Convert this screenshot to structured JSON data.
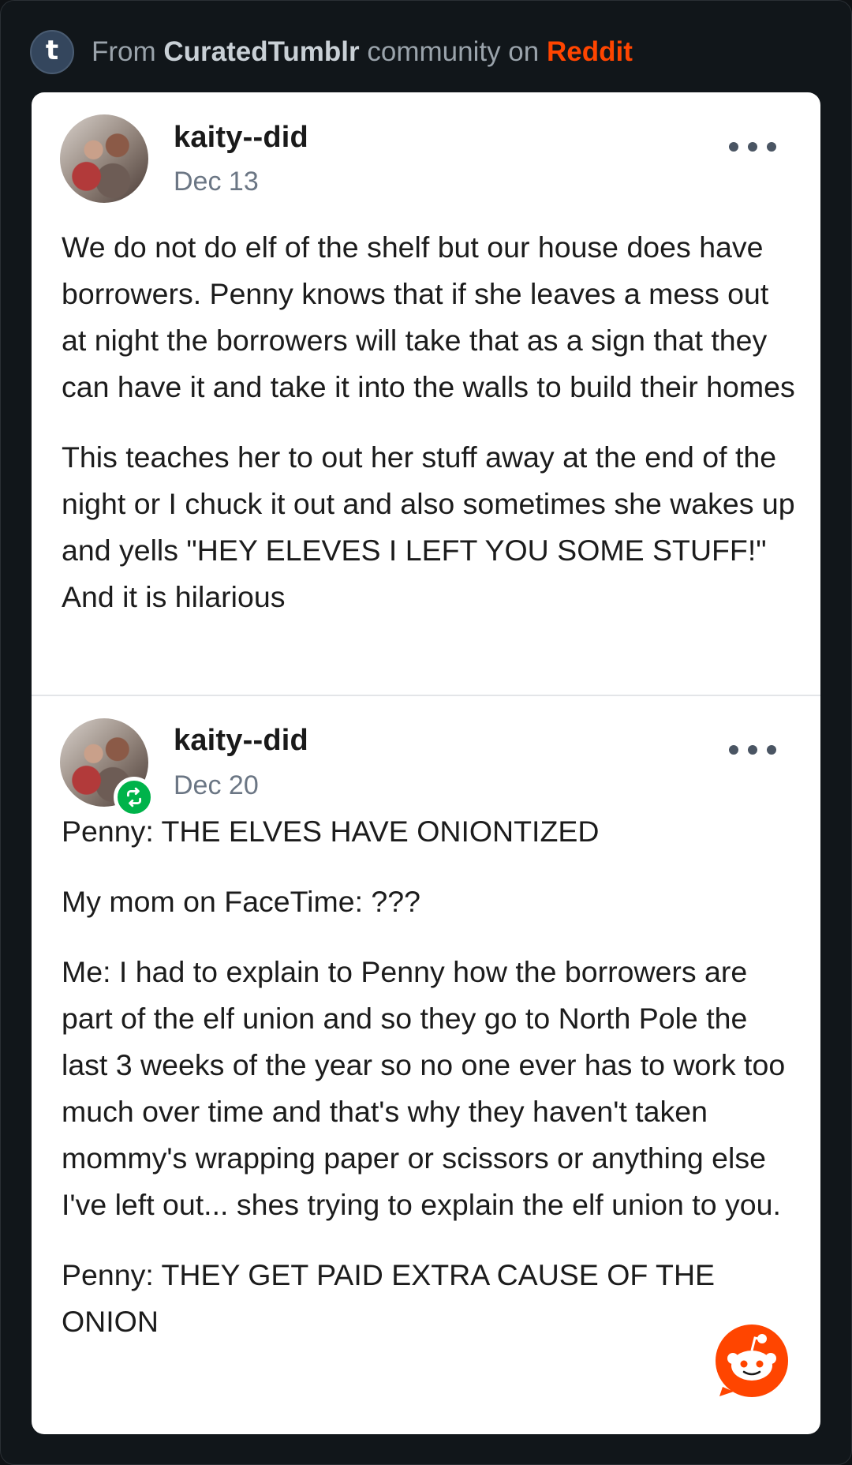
{
  "header": {
    "prefix": "From",
    "community": "CuratedTumblr",
    "middle": "community on",
    "platform": "Reddit",
    "logo_letter": "t"
  },
  "posts": [
    {
      "username": "kaity--did",
      "date": "Dec 13",
      "reblogged": false,
      "paragraphs": [
        "We do not do elf of the shelf but our house does have borrowers. Penny knows that if she leaves a mess out at night the borrowers will take that as a sign that they can have it and take it into the walls to build their homes",
        "This teaches her to out her stuff away at the end of the night or I chuck it out and also sometimes she wakes up and yells \"HEY ELEVES I LEFT YOU SOME STUFF!\" And it is hilarious"
      ]
    },
    {
      "username": "kaity--did",
      "date": "Dec 20",
      "reblogged": true,
      "paragraphs": [
        "Penny: THE ELVES HAVE ONIONTIZED",
        "My mom on FaceTime: ???",
        "Me: I had to explain to Penny how the borrowers are part of the elf union and so they go to North Pole the last 3 weeks of the year so no one ever has to work too much over time and that's why they haven't taken mommy's wrapping paper or scissors or anything else I've left out... shes trying to explain the elf union to you.",
        "Penny: THEY GET PAID EXTRA CAUSE OF THE ONION"
      ]
    }
  ],
  "icons": {
    "more": "more-horizontal-icon",
    "reblog": "reblog-icon",
    "reddit": "reddit-snoo-icon"
  },
  "colors": {
    "background": "#0f1215",
    "card": "#ffffff",
    "reddit_orange": "#ff4500",
    "tumblr_navy": "#34465d",
    "reblog_green": "#00b34a"
  }
}
